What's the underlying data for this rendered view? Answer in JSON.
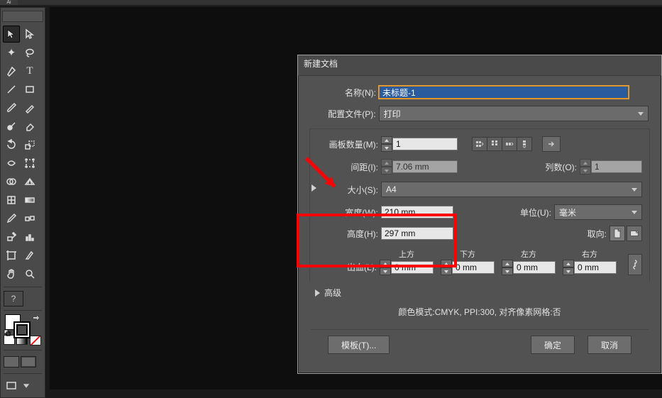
{
  "app": {
    "abbrev": "Ai"
  },
  "dialog": {
    "title": "新建文档",
    "name_label": "名称(N):",
    "name_value": "未标题-1",
    "profile_label": "配置文件(P):",
    "profile_value": "打印",
    "artboards_label": "画板数量(M):",
    "artboards_value": "1",
    "spacing_label": "间距(I):",
    "spacing_value": "7.06 mm",
    "columns_label": "列数(O):",
    "columns_value": "1",
    "size_label": "大小(S):",
    "size_value": "A4",
    "width_label": "宽度(W):",
    "width_value": "210 mm",
    "height_label": "高度(H):",
    "height_value": "297 mm",
    "units_label": "单位(U):",
    "units_value": "毫米",
    "orientation_label": "取向:",
    "bleed_label": "出血(L):",
    "bleed_top": "上方",
    "bleed_bottom": "下方",
    "bleed_left": "左方",
    "bleed_right": "右方",
    "bleed_value": "0 mm",
    "advanced_label": "高级",
    "info": "颜色模式:CMYK, PPI:300, 对齐像素网格:否",
    "template_btn": "模板(T)...",
    "ok_btn": "确定",
    "cancel_btn": "取消"
  },
  "tools": {
    "help": "?"
  }
}
